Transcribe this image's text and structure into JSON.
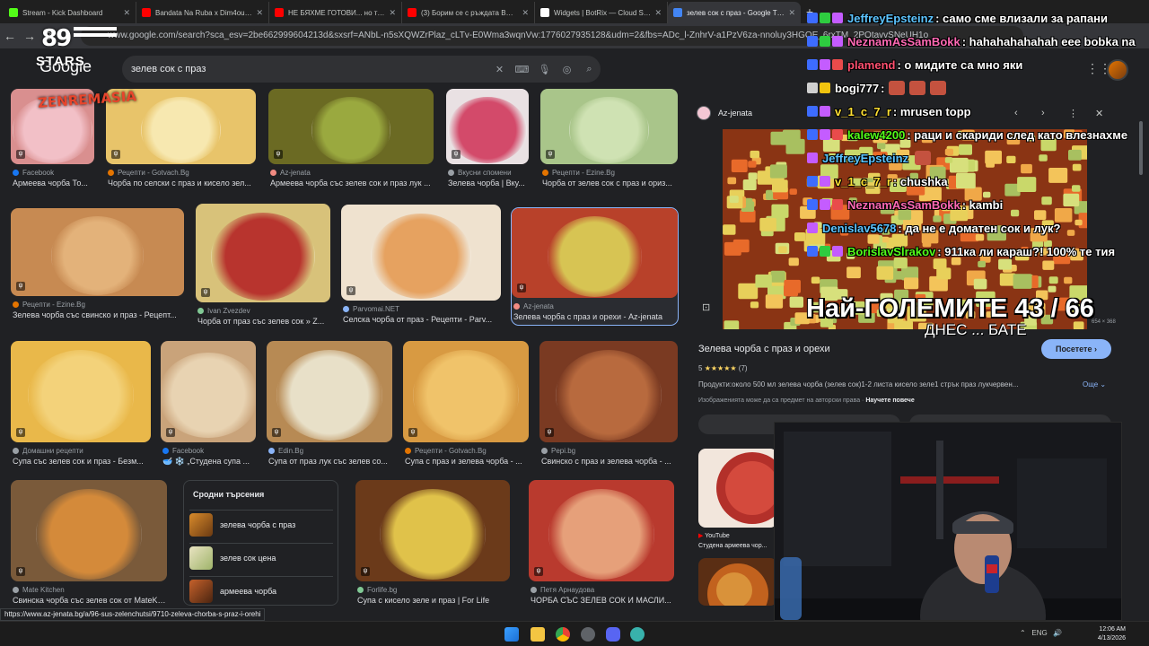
{
  "browser": {
    "tabs": [
      {
        "title": "Stream - Kick Dashboard",
        "fav": "kick-icon",
        "color": "#53fc18"
      },
      {
        "title": "Bandata Na Ruba x Dim4ou - Л",
        "fav": "youtube-icon",
        "color": "#ff0000"
      },
      {
        "title": "НЕ БЯХМЕ ГОТОВИ... но тръгн",
        "fav": "youtube-icon",
        "color": "#ff0000"
      },
      {
        "title": "(3) Борим се с ръждата BMW",
        "fav": "youtube-icon",
        "color": "#ff0000"
      },
      {
        "title": "Widgets | BotRix — Cloud Strea",
        "fav": "botrix-icon",
        "color": "#ffffff"
      },
      {
        "title": "зелев сок с праз - Google Търс",
        "fav": "google-icon",
        "color": "#4285f4"
      }
    ],
    "url": "www.google.com/search?sca_esv=2be662999604213d&sxsrf=ANbL-n5sXQWZrPlaz_cLTv-E0Wma3wqnVw:1776027935128&udm=2&fbs=ADc_l-ZnhrV-a1PzV6za-nnoluy3HGOE_6rxTM_2POtavvSNeUH1o"
  },
  "overlay": {
    "logo_number": "89",
    "logo_stars": "STARS",
    "logo_zen": "ZENREMASIA",
    "big_text": "Най-ГОЛЕМИТЕ 43 / 66",
    "sub_text": "ДНЕС ... БАТЕ"
  },
  "google": {
    "logo": "Google",
    "query": "зелев сок с праз"
  },
  "results": [
    {
      "source": "Facebook",
      "caption": "Армеева чорба То...",
      "src_color": "#1877f2"
    },
    {
      "source": "Рецепти - Gotvach.Bg",
      "caption": "Чорба по селски с праз и кисело зел...",
      "src_color": "#e37400"
    },
    {
      "source": "Az-jenata",
      "caption": "Армеева чорба със зелев сок и праз лук ...",
      "src_color": "#f28b82"
    },
    {
      "source": "Вкусни спомени",
      "caption": "Зелева чорба | Вку...",
      "src_color": "#9aa0a6"
    },
    {
      "source": "Рецепти - Ezine.Bg",
      "caption": "Чорба от зелев сок с праз и ориз...",
      "src_color": "#e37400"
    },
    {
      "source": "Рецепти - Ezine.Bg",
      "caption": "Зелева чорба със свинско и праз - Рецепт...",
      "src_color": "#e37400"
    },
    {
      "source": "Ivan Zvezdev",
      "caption": "Чорба от праз със зелев сок » Z...",
      "src_color": "#81c995"
    },
    {
      "source": "Parvomai.NET",
      "caption": "Селска чорба от праз - Рецепти - Parv...",
      "src_color": "#8ab4f8"
    },
    {
      "source": "Az-jenata",
      "caption": "Зелева чорба с праз и орехи - Az-jenata",
      "src_color": "#f28b82"
    },
    {
      "source": "Домашни рецепти",
      "caption": "Супа със зелев сок и праз - Безм...",
      "src_color": "#9aa0a6"
    },
    {
      "source": "Facebook",
      "caption": "🥣 ❄️ „Студена супа ...",
      "src_color": "#1877f2"
    },
    {
      "source": "Edin.Bg",
      "caption": "Супа от праз лук със зелев со...",
      "src_color": "#8ab4f8"
    },
    {
      "source": "Рецепти - Gotvach.Bg",
      "caption": "Супа с праз и зелева чорба - ...",
      "src_color": "#e37400"
    },
    {
      "source": "Pepi.bg",
      "caption": "Свинско с праз и зелева чорба - ...",
      "src_color": "#9aa0a6"
    },
    {
      "source": "Mate Kitchen",
      "caption": "Свинска чорба със зелев сок от MateKit...",
      "src_color": "#9aa0a6"
    },
    {
      "source": "Forlife.bg",
      "caption": "Супа с кисело зеле и праз | For Life",
      "src_color": "#81c995"
    },
    {
      "source": "Петя Арнаудова",
      "caption": "ЧОРБА СЪС ЗЕЛЕВ СОК И МАСЛИ...",
      "src_color": "#9aa0a6"
    }
  ],
  "related": {
    "title": "Сродни търсения",
    "items": [
      {
        "text": "зелева чорба с праз",
        "bold": "зелева чорба"
      },
      {
        "text": "зелев сок цена",
        "bold": "цена"
      },
      {
        "text": "армеева чорба",
        "bold": "армеева чорба"
      }
    ]
  },
  "panel": {
    "source": "Az-jenata",
    "dims": "654 × 368",
    "title": "Зелева чорба с праз и орехи",
    "visit": "Посетете",
    "rating": "5",
    "stars": "★★★★★",
    "rating_count": "(7)",
    "products": "Продукти:около 500 мл зелева чорба (зелев сок)1-2 листа кисело зеле1 стрък праз лукчервен...",
    "more": "Още",
    "rights": "Изображенията може да са предмет на авторски права",
    "learn_more": "Научете повече",
    "yt_source": "YouTube",
    "yt_caption": "Студена армеева чор..."
  },
  "chat": [
    {
      "user": "JeffreyEpsteinz",
      "text": ": само сме влизали за рапани",
      "color": "#5cc4ff"
    },
    {
      "user": "NeznamAsSamBokk",
      "text": ": hahahahahahah eee bobka na",
      "color": "#ff69b4"
    },
    {
      "user": "plamend",
      "text": ": о мидите са мно яки",
      "color": "#ff4f6f"
    },
    {
      "user": "bogi777",
      "text": ":",
      "color": "#ffffff"
    },
    {
      "user": "v_1_c_7_r",
      "text": ": mrusen topp",
      "color": "#ffe033"
    },
    {
      "user": "kalew4200",
      "text": ": раци и скариди след като влезнахме",
      "color": "#53fc18"
    },
    {
      "user": "JeffreyEpsteinz",
      "text": "",
      "color": "#5cc4ff"
    },
    {
      "user": "v_1_c_7_r",
      "text": ": chushka",
      "color": "#ffe033"
    },
    {
      "user": "NeznamAsSamBokk",
      "text": ": kambi",
      "color": "#ff69b4"
    },
    {
      "user": "Denislav5678",
      "text": ": да не е доматен сок и лук?",
      "color": "#5cc4ff"
    },
    {
      "user": "BorislavSlrakov",
      "text": ": 911ка ли караш?! 100% те тия",
      "color": "#53fc18"
    }
  ],
  "status_url": "https://www.az-jenata.bg/a/96-sus-zelenchutsi/9710-zeleva-chorba-s-praz-i-orehi",
  "taskbar": {
    "time": "12:06 AM",
    "date": "4/13/2026",
    "lang": "ENG"
  }
}
